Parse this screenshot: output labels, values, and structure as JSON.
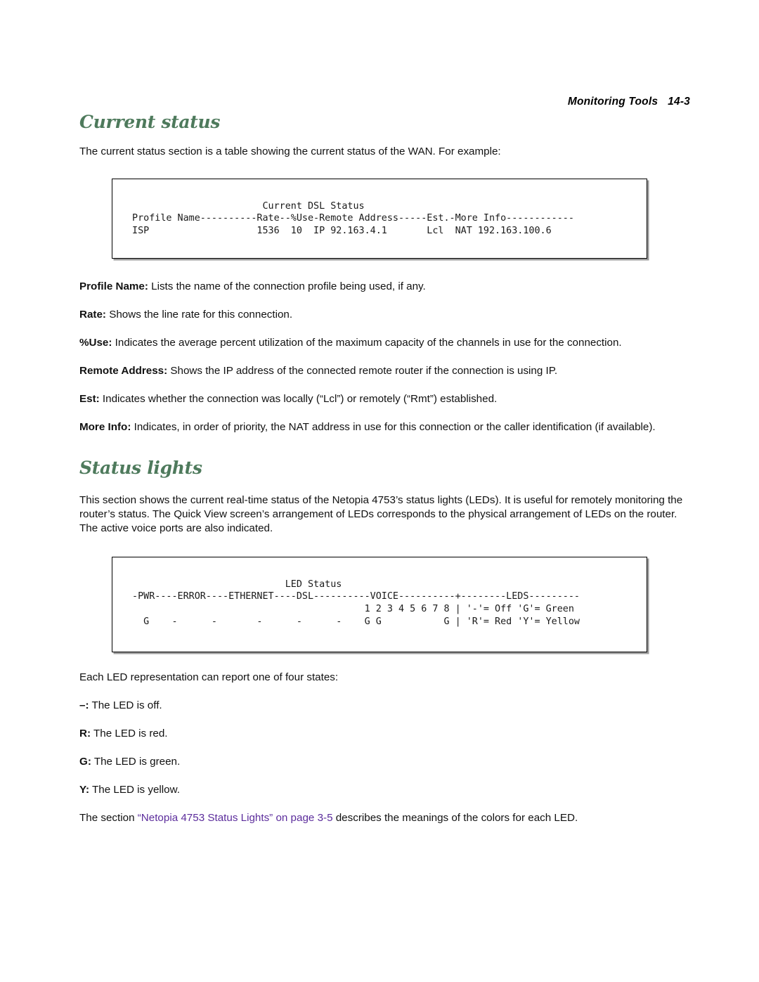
{
  "running_header": {
    "title": "Monitoring Tools",
    "page_number": "14-3"
  },
  "sections": [
    {
      "heading": "Current status",
      "intro": "The current status section is a table showing the current status of the WAN. For example:"
    },
    {
      "heading": "Status lights",
      "intro": "This section shows the current real-time status of the Netopia 4753’s status lights (LEDs). It is useful for remotely monitoring the router’s status. The Quick View screen’s arrangement of LEDs corresponds to the physical arrangement of LEDs on the router. The active voice ports are also indicated."
    }
  ],
  "terminal_dsl": {
    "title": "Current DSL Status",
    "lines": [
      "                        Current DSL Status",
      " Profile Name----------Rate--%Use-Remote Address-----Est.-More Info------------",
      " ISP                   1536  10  IP 92.163.4.1       Lcl  NAT 192.163.100.6"
    ]
  },
  "terminal_led": {
    "title": "LED Status",
    "lines": [
      "                            LED Status",
      " -PWR----ERROR----ETHERNET----DSL----------VOICE----------+--------LEDS---------",
      "                                          1 2 3 4 5 6 7 8 | '-'= Off 'G'= Green",
      "   G    -      -       -      -      -    G G           G | 'R'= Red 'Y'= Yellow"
    ]
  },
  "definitions_dsl": [
    {
      "term": "Profile Name:",
      "text": " Lists the name of the connection profile being used, if any."
    },
    {
      "term": "Rate:",
      "text": " Shows the line rate for this connection."
    },
    {
      "term": "%Use:",
      "text": " Indicates the average percent utilization of the maximum capacity of the channels in use for the connection."
    },
    {
      "term": "Remote Address:",
      "text": " Shows the IP address of the connected remote router if the connection is using IP."
    },
    {
      "term": "Est:",
      "text": " Indicates whether the connection was locally (“Lcl”) or remotely (“Rmt”) established."
    },
    {
      "term": "More Info:",
      "text": " Indicates, in order of priority, the NAT address in use for this connection or the caller identification (if available)."
    }
  ],
  "led_states": {
    "intro": "Each LED representation can report one of four states:",
    "items": [
      {
        "term": "–:",
        "text": " The LED is off."
      },
      {
        "term": "R:",
        "text": " The LED is red."
      },
      {
        "term": "G:",
        "text": " The LED is green."
      },
      {
        "term": "Y:",
        "text": " The LED is yellow."
      }
    ]
  },
  "cross_reference": {
    "prefix": "The section ",
    "link": "“Netopia 4753 Status Lights” on page 3-5",
    "suffix": " describes the meanings of the colors for each LED."
  },
  "colors": {
    "heading_green": "#4e7a5c",
    "xref_purple": "#5c2d9c",
    "body_text": "#111111",
    "box_border": "#000000"
  }
}
